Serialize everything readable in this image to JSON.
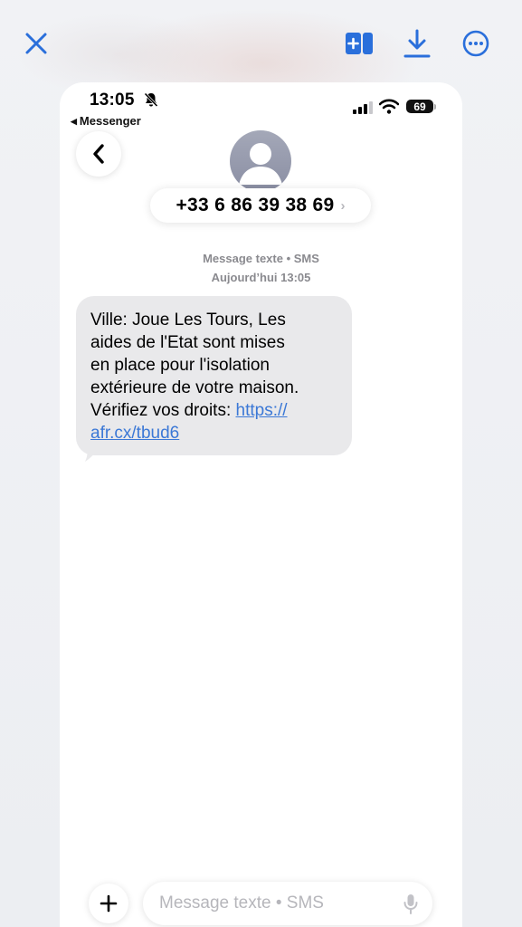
{
  "viewer": {
    "icons": {
      "close": "close-icon",
      "add_to_conversation": "add-to-conversation-icon",
      "download": "download-icon",
      "more": "more-icon"
    },
    "accent_color": "#2a6fdb"
  },
  "status_bar": {
    "time": "13:05",
    "back_app": "Messenger",
    "battery": "69"
  },
  "conversation": {
    "contact_number": "+33 6 86 39 38 69",
    "contact_chevron": "›",
    "service_label": "Message texte • SMS",
    "date_label": "Aujourd’hui 13:05",
    "message": {
      "line1": "Ville: Joue Les Tours, Les",
      "line2": "aides de l'Etat sont mises",
      "line3": "en place pour l'isolation",
      "line4": "extérieure de votre maison.",
      "line5_text": "Vérifiez vos droits: ",
      "link_part1": "https://",
      "link_part2": "afr.cx/tbud6"
    }
  },
  "compose": {
    "placeholder": "Message texte • SMS"
  }
}
